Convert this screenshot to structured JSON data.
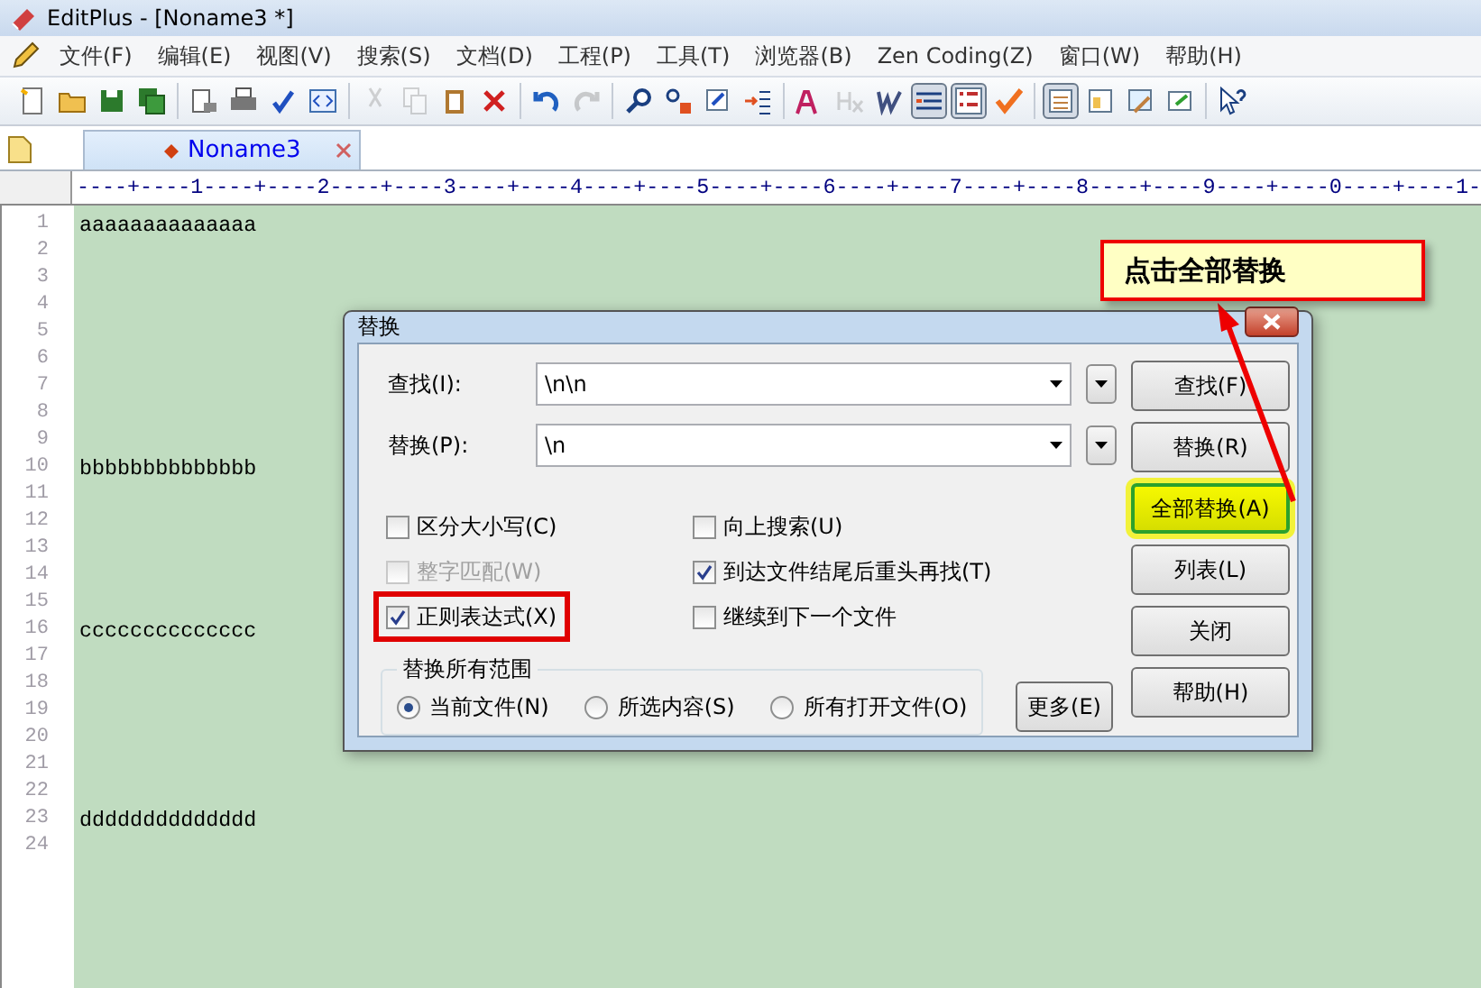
{
  "window": {
    "title": "EditPlus - [Noname3 *]"
  },
  "menu": [
    "文件(F)",
    "编辑(E)",
    "视图(V)",
    "搜索(S)",
    "文档(D)",
    "工程(P)",
    "工具(T)",
    "浏览器(B)",
    "Zen Coding(Z)",
    "窗口(W)",
    "帮助(H)"
  ],
  "toolbar": [
    [
      {
        "disabled": false,
        "pressed": false
      },
      {
        "disabled": false,
        "pressed": false
      },
      {
        "disabled": false,
        "pressed": false
      },
      {
        "disabled": false,
        "pressed": false
      }
    ],
    [
      {
        "disabled": false,
        "pressed": false
      },
      {
        "disabled": false,
        "pressed": false
      },
      {
        "disabled": false,
        "pressed": false
      },
      {
        "disabled": false,
        "pressed": false
      }
    ],
    [
      {
        "disabled": true,
        "pressed": false
      },
      {
        "disabled": true,
        "pressed": false
      },
      {
        "disabled": false,
        "pressed": false
      },
      {
        "disabled": false,
        "pressed": false
      }
    ],
    [
      {
        "disabled": false,
        "pressed": false
      },
      {
        "disabled": true,
        "pressed": false
      }
    ],
    [
      {
        "disabled": false,
        "pressed": false
      },
      {
        "disabled": false,
        "pressed": false
      },
      {
        "disabled": false,
        "pressed": false
      },
      {
        "disabled": false,
        "pressed": false
      }
    ],
    [
      {
        "disabled": false,
        "pressed": false
      },
      {
        "disabled": true,
        "pressed": false
      },
      {
        "disabled": false,
        "pressed": false
      },
      {
        "disabled": false,
        "pressed": true
      },
      {
        "disabled": false,
        "pressed": true
      },
      {
        "disabled": false,
        "pressed": false
      }
    ],
    [
      {
        "disabled": false,
        "pressed": true
      },
      {
        "disabled": false,
        "pressed": false
      },
      {
        "disabled": false,
        "pressed": false
      },
      {
        "disabled": false,
        "pressed": false
      }
    ],
    [
      {
        "disabled": false,
        "pressed": false
      }
    ]
  ],
  "tabs": [
    {
      "label": "Noname3",
      "selected": true
    }
  ],
  "ruler": "----+----1----+----2----+----3----+----4----+----5----+----6----+----7----+----8----+----9----+----0----+----1-",
  "lines": [
    {
      "number": "1",
      "text": "aaaaaaaaaaaaaa"
    },
    {
      "number": "2"
    },
    {
      "number": "3"
    },
    {
      "number": "4"
    },
    {
      "number": "5"
    },
    {
      "number": "6"
    },
    {
      "number": "7"
    },
    {
      "number": "8"
    },
    {
      "number": "9"
    },
    {
      "number": "10",
      "text": "bbbbbbbbbbbbbb"
    },
    {
      "number": "11"
    },
    {
      "number": "12"
    },
    {
      "number": "13"
    },
    {
      "number": "14"
    },
    {
      "number": "15"
    },
    {
      "number": "16",
      "text": "cccccccccccccc"
    },
    {
      "number": "17"
    },
    {
      "number": "18"
    },
    {
      "number": "19"
    },
    {
      "number": "20"
    },
    {
      "number": "21"
    },
    {
      "number": "22"
    },
    {
      "number": "23",
      "text": "dddddddddddddd"
    },
    {
      "number": "24"
    }
  ],
  "dialog": {
    "title": "替换",
    "fields": [
      {
        "label": "查找(I):",
        "value": "\\n\\n"
      },
      {
        "label": "替换(P):",
        "value": "\\n"
      }
    ],
    "options": [
      {
        "label": "区分大小写(C)",
        "checked": false,
        "disabled": false,
        "highlighted": false
      },
      {
        "label": "向上搜索(U)",
        "checked": false,
        "disabled": false,
        "highlighted": false
      },
      {
        "label": "整字匹配(W)",
        "checked": false,
        "disabled": true,
        "highlighted": false
      },
      {
        "label": "到达文件结尾后重头再找(T)",
        "checked": true,
        "disabled": false,
        "highlighted": false
      },
      {
        "label": "正则表达式(X)",
        "checked": true,
        "disabled": false,
        "highlighted": true
      },
      {
        "label": "继续到下一个文件",
        "checked": false,
        "disabled": false,
        "highlighted": false
      }
    ],
    "scope": {
      "title": "替换所有范围",
      "options": [
        {
          "label": "当前文件(N)",
          "selected": true
        },
        {
          "label": "所选内容(S)",
          "selected": false
        },
        {
          "label": "所有打开文件(O)",
          "selected": false
        }
      ]
    },
    "buttons": [
      {
        "label": "查找(F)",
        "highlighted": false
      },
      {
        "label": "替换(R)",
        "highlighted": false
      },
      {
        "label": "全部替换(A)",
        "highlighted": true
      },
      {
        "label": "列表(L)",
        "highlighted": false
      },
      {
        "label": "关闭",
        "highlighted": false
      },
      {
        "label": "帮助(H)",
        "highlighted": false
      }
    ],
    "more_button": "更多(E)"
  },
  "callout": {
    "text": "点击全部替换"
  }
}
